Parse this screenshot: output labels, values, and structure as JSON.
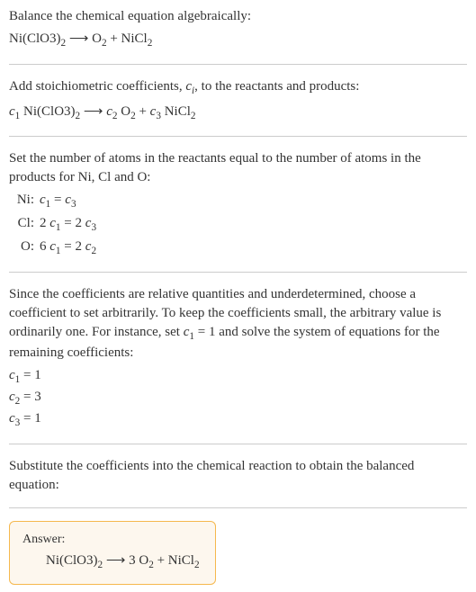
{
  "s1": {
    "text": "Balance the chemical equation algebraically:",
    "eq_parts": [
      "Ni(ClO3)",
      "2",
      " ⟶ O",
      "2",
      " + NiCl",
      "2"
    ]
  },
  "s2": {
    "text_a": "Add stoichiometric coefficients, ",
    "ci": "c",
    "ci_sub": "i",
    "text_b": ", to the reactants and products:",
    "eq": {
      "c1": "c",
      "s1": "1",
      "r1": " Ni(ClO3)",
      "rs1": "2",
      "arrow": " ⟶ ",
      "c2": "c",
      "s2": "2",
      "r2": " O",
      "rs2": "2",
      "plus": " + ",
      "c3": "c",
      "s3": "3",
      "r3": " NiCl",
      "rs3": "2"
    }
  },
  "s3": {
    "text": "Set the number of atoms in the reactants equal to the number of atoms in the products for Ni, Cl and O:",
    "rows": [
      {
        "lbl": "Ni:",
        "lhs_c": "c",
        "lhs_s": "1",
        "eq": " = ",
        "rhs_c": "c",
        "rhs_s": "3",
        "pre": "",
        "mid": ""
      },
      {
        "lbl": "Cl:",
        "pre": "2 ",
        "lhs_c": "c",
        "lhs_s": "1",
        "eq": " = 2 ",
        "rhs_c": "c",
        "rhs_s": "3",
        "mid": ""
      },
      {
        "lbl": "O:",
        "pre": "6 ",
        "lhs_c": "c",
        "lhs_s": "1",
        "eq": " = 2 ",
        "rhs_c": "c",
        "rhs_s": "2",
        "mid": ""
      }
    ]
  },
  "s4": {
    "text_a": "Since the coefficients are relative quantities and underdetermined, choose a coefficient to set arbitrarily. To keep the coefficients small, the arbitrary value is ordinarily one. For instance, set ",
    "c": "c",
    "cs": "1",
    "text_b": " = 1 and solve the system of equations for the remaining coefficients:",
    "sol": [
      {
        "c": "c",
        "s": "1",
        "v": " = 1"
      },
      {
        "c": "c",
        "s": "2",
        "v": " = 3"
      },
      {
        "c": "c",
        "s": "3",
        "v": " = 1"
      }
    ]
  },
  "s5": {
    "text": "Substitute the coefficients into the chemical reaction to obtain the balanced equation:"
  },
  "answer": {
    "label": "Answer:",
    "eq_parts": [
      "Ni(ClO3)",
      "2",
      " ⟶ 3 O",
      "2",
      " + NiCl",
      "2"
    ]
  }
}
